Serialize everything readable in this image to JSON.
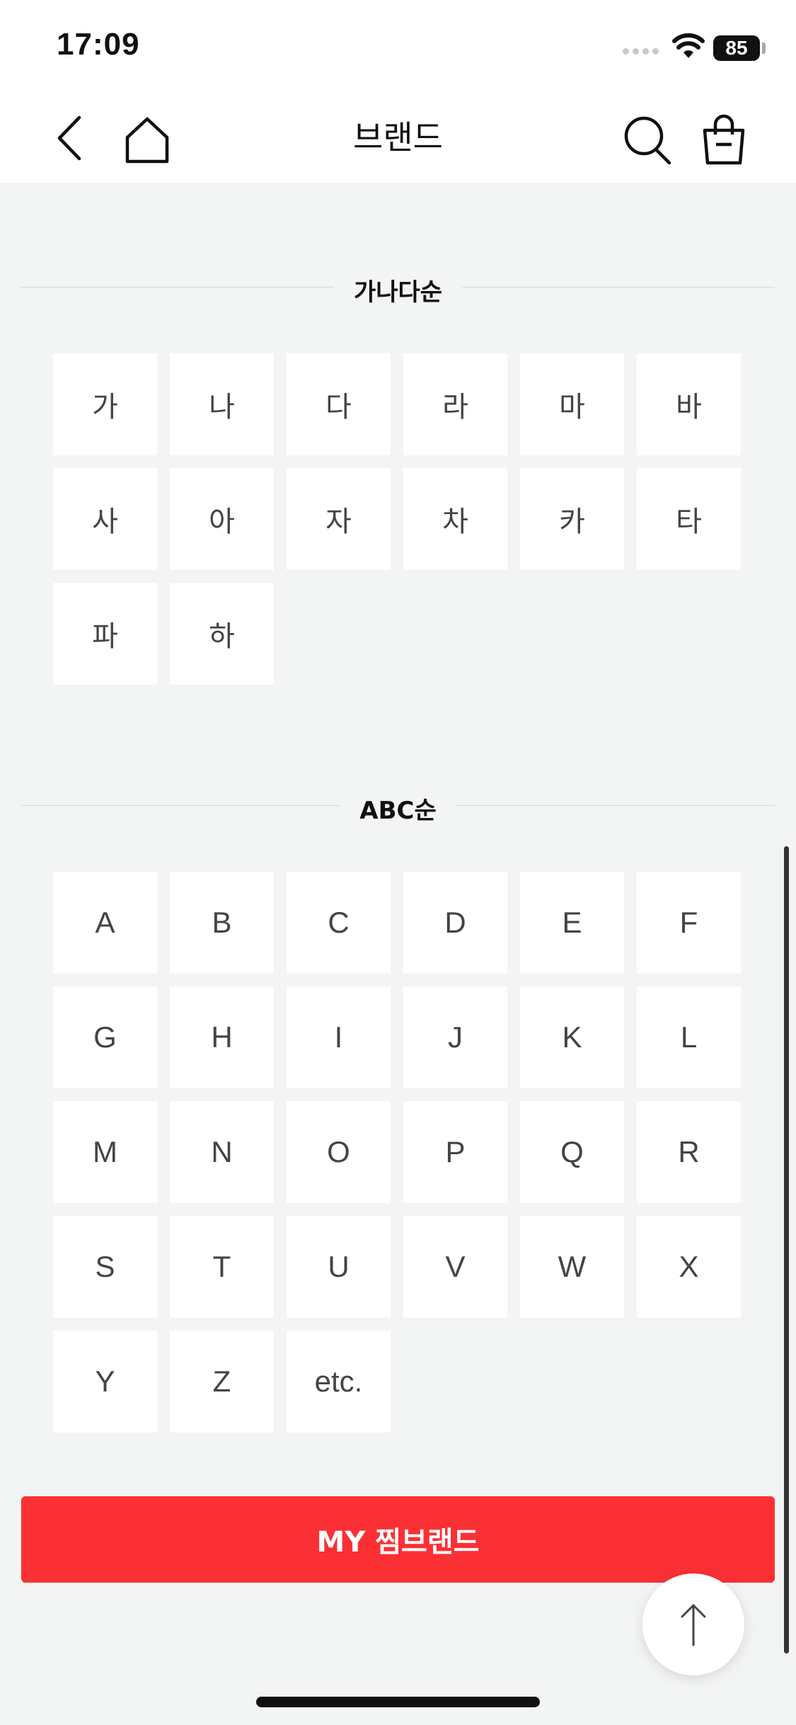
{
  "status_bar": {
    "time": "17:09",
    "battery": "85"
  },
  "nav": {
    "title": "브랜드",
    "back_icon": "chevron-left-icon",
    "home_icon": "home-icon",
    "search_icon": "search-icon",
    "cart_icon": "shopping-bag-icon"
  },
  "korean_section": {
    "title": "가나다순",
    "items": [
      "가",
      "나",
      "다",
      "라",
      "마",
      "바",
      "사",
      "아",
      "자",
      "차",
      "카",
      "타",
      "파",
      "하"
    ]
  },
  "latin_section": {
    "title": "ABC순",
    "items": [
      "A",
      "B",
      "C",
      "D",
      "E",
      "F",
      "G",
      "H",
      "I",
      "J",
      "K",
      "L",
      "M",
      "N",
      "O",
      "P",
      "Q",
      "R",
      "S",
      "T",
      "U",
      "V",
      "W",
      "X",
      "Y",
      "Z",
      "etc."
    ]
  },
  "my_brand_button": {
    "label": "MY 찜브랜드"
  },
  "colors": {
    "accent": "#fb3034",
    "background": "#f3f4f4"
  },
  "scroll_top_icon": "arrow-up-icon"
}
